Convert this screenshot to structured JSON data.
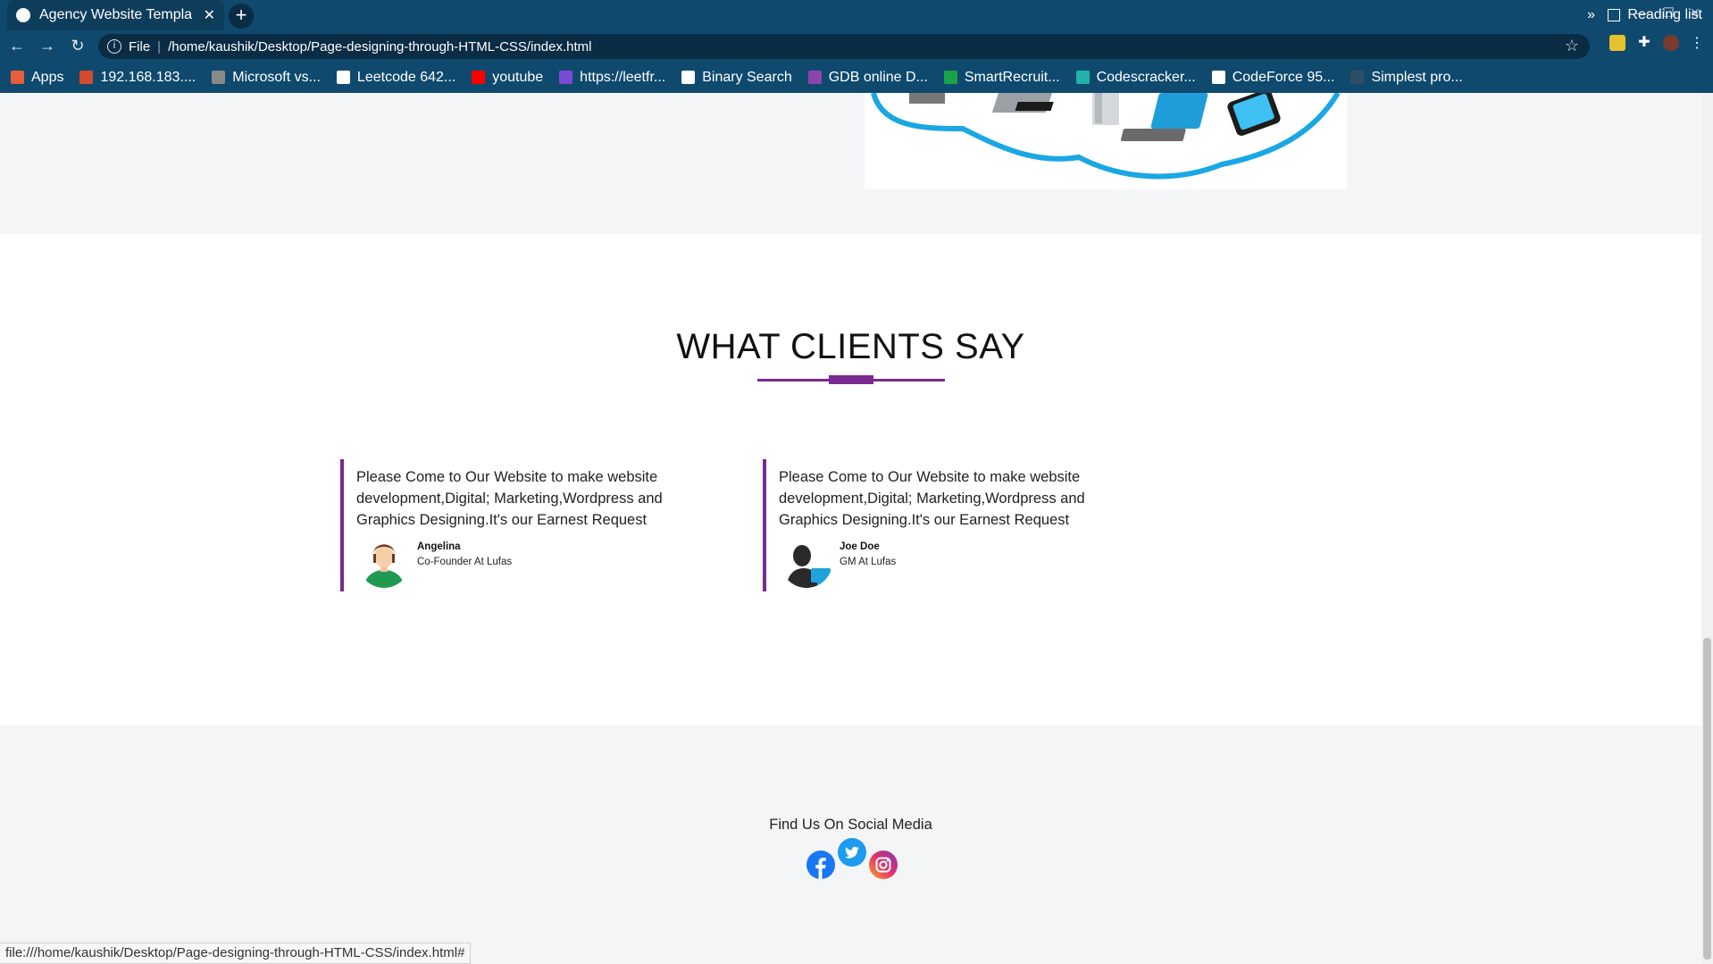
{
  "browser": {
    "tab_title": "Agency Website Templa",
    "url_prefix": "File",
    "url": "/home/kaushik/Desktop/Page-designing-through-HTML-CSS/index.html",
    "bookmarks": [
      {
        "label": "Apps",
        "icon": "apps-grid-icon",
        "color": "#e85d3a"
      },
      {
        "label": "192.168.183....",
        "icon": "router-icon",
        "color": "#d44a2d"
      },
      {
        "label": "Microsoft vs...",
        "icon": "signal-icon",
        "color": "#8a8a8a"
      },
      {
        "label": "Leetcode 642...",
        "icon": "code-icon",
        "color": "#ffffff"
      },
      {
        "label": "youtube",
        "icon": "youtube-icon",
        "color": "#ff0000"
      },
      {
        "label": "https://leetfr...",
        "icon": "hash-icon",
        "color": "#7b4bd6"
      },
      {
        "label": "Binary Search",
        "icon": "binary-search-icon",
        "color": "#ffffff"
      },
      {
        "label": "GDB online D...",
        "icon": "gdb-icon",
        "color": "#8e44ad"
      },
      {
        "label": "SmartRecruit...",
        "icon": "smartrecruiters-icon",
        "color": "#1aa34a"
      },
      {
        "label": "Codescracker...",
        "icon": "codescracker-icon",
        "color": "#20b2aa"
      },
      {
        "label": "CodeForce 95...",
        "icon": "pdf-icon",
        "color": "#ffffff"
      },
      {
        "label": "Simplest pro...",
        "icon": "page-icon",
        "color": "#2c4f66"
      }
    ],
    "more_bookmarks": "»",
    "reading_list": "Reading list",
    "status_text": "file:///home/kaushik/Desktop/Page-designing-through-HTML-CSS/index.html#"
  },
  "clients": {
    "title": "WHAT CLIENTS SAY",
    "testimonials": [
      {
        "quote": "Please Come to Our Website to make website development,Digital; Marketing,Wordpress and Graphics Designing.It's our Earnest Request",
        "name": "Angelina",
        "role": "Co-Founder At Lufas"
      },
      {
        "quote": "Please Come to Our Website to make website development,Digital; Marketing,Wordpress and Graphics Designing.It's our Earnest Request",
        "name": "Joe Doe",
        "role": "GM At Lufas"
      }
    ]
  },
  "footer": {
    "title": "Find Us On Social Media",
    "social": [
      "facebook-icon",
      "twitter-icon",
      "instagram-icon"
    ]
  },
  "colors": {
    "chrome_bg": "#0f4a6e",
    "accent_purple": "#7a2a8f",
    "section_gray": "#f4f5f7"
  }
}
